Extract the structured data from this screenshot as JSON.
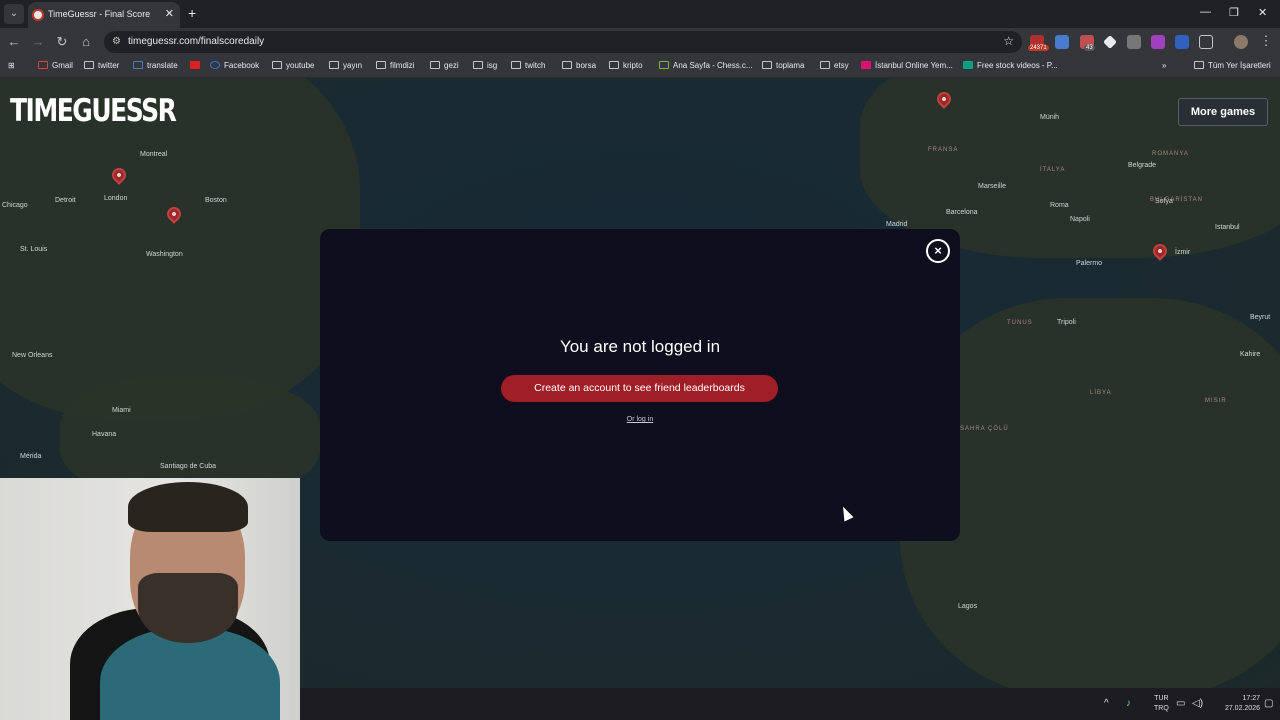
{
  "browser": {
    "tab_title": "TimeGuessr - Final Score",
    "url": "timeguessr.com/finalscoredaily",
    "extension_badges": [
      "24371",
      "43"
    ],
    "bookmarks": [
      {
        "label": "Gmail",
        "icon": "gmail-icon"
      },
      {
        "label": "twitter",
        "icon": "x-icon"
      },
      {
        "label": "translate",
        "icon": "translate-icon"
      },
      {
        "label": "",
        "icon": "youtube-icon"
      },
      {
        "label": "Facebook",
        "icon": "facebook-icon"
      },
      {
        "label": "youtube",
        "icon": "folder-icon"
      },
      {
        "label": "yayın",
        "icon": "folder-icon"
      },
      {
        "label": "filmdizi",
        "icon": "folder-icon"
      },
      {
        "label": "gezi",
        "icon": "folder-icon"
      },
      {
        "label": "isg",
        "icon": "folder-icon"
      },
      {
        "label": "twitch",
        "icon": "folder-icon"
      },
      {
        "label": "borsa",
        "icon": "folder-icon"
      },
      {
        "label": "kripto",
        "icon": "folder-icon"
      },
      {
        "label": "Ana Sayfa - Chess.c...",
        "icon": "chess-icon"
      },
      {
        "label": "toplama",
        "icon": "folder-icon"
      },
      {
        "label": "etsy",
        "icon": "folder-icon"
      },
      {
        "label": "İstanbul Online Yem...",
        "icon": "yemek-icon"
      },
      {
        "label": "Free stock videos - P...",
        "icon": "pexels-icon"
      }
    ],
    "all_bookmarks": "Tüm Yer İşaretleri"
  },
  "page": {
    "logo": "TIMEGUESSR",
    "more_games": "More games",
    "map_labels": {
      "cities": [
        {
          "name": "Montreal"
        },
        {
          "name": "Chicago"
        },
        {
          "name": "Detroit"
        },
        {
          "name": "London"
        },
        {
          "name": "Boston"
        },
        {
          "name": "St. Louis"
        },
        {
          "name": "Washington"
        },
        {
          "name": "New Orleans"
        },
        {
          "name": "Miami"
        },
        {
          "name": "Havana"
        },
        {
          "name": "Santiago de Cuba"
        },
        {
          "name": "Mérida"
        },
        {
          "name": "Madrid"
        },
        {
          "name": "Barcelona"
        },
        {
          "name": "Marseille"
        },
        {
          "name": "Roma"
        },
        {
          "name": "Napoli"
        },
        {
          "name": "Belgrade"
        },
        {
          "name": "Istanbul"
        },
        {
          "name": "İzmir"
        },
        {
          "name": "Tripoli"
        },
        {
          "name": "Beyrut"
        },
        {
          "name": "Kahire"
        },
        {
          "name": "Lagos"
        },
        {
          "name": "Münih"
        },
        {
          "name": "Sofya"
        },
        {
          "name": "Palermo"
        }
      ],
      "countries": [
        {
          "name": "FRANSA"
        },
        {
          "name": "İTALYA"
        },
        {
          "name": "ROMANYA"
        },
        {
          "name": "BULGARİSTAN"
        },
        {
          "name": "TUNUS"
        },
        {
          "name": "LİBYA"
        },
        {
          "name": "MISIR"
        },
        {
          "name": "SAHRA ÇÖLÜ"
        }
      ]
    }
  },
  "modal": {
    "title": "You are not logged in",
    "create_button": "Create an account to see friend leaderboards",
    "login_link": "Or log in",
    "close": "×"
  },
  "taskbar": {
    "lang_top": "TUR",
    "lang_bottom": "TRQ",
    "time": "17:27",
    "date": "27.02.2026"
  }
}
